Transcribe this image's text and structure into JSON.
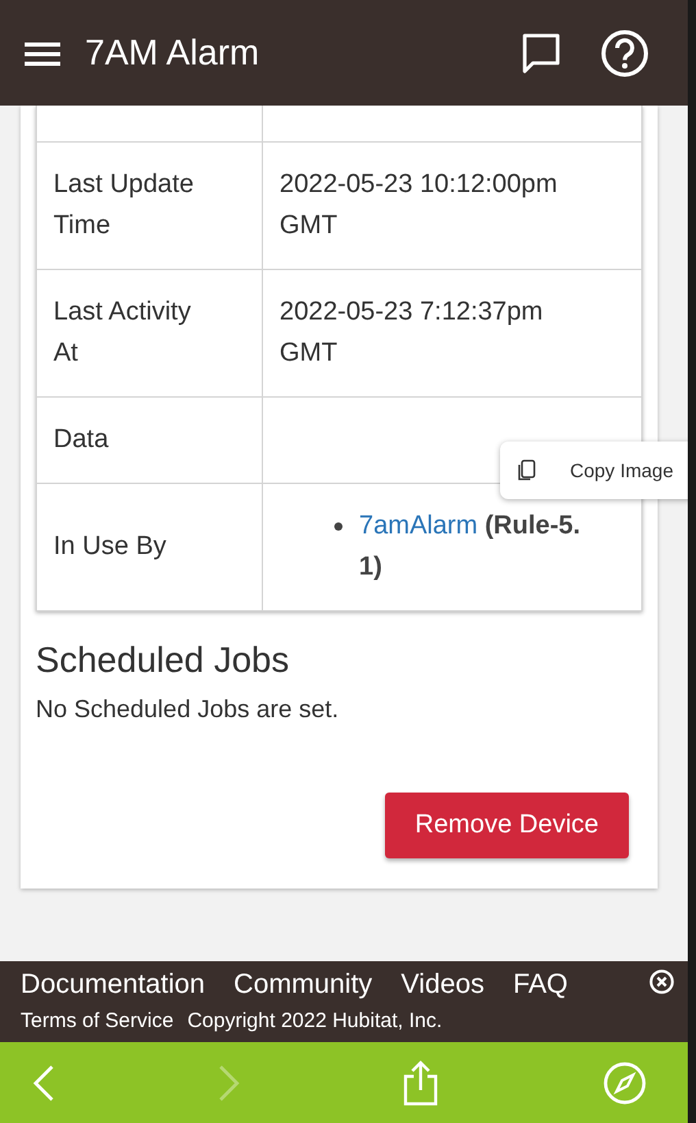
{
  "app_bar": {
    "title": "7AM Alarm"
  },
  "table": {
    "rows": [
      {
        "label": "Last Update Time",
        "value": "2022-05-23 10:12:00pm GMT"
      },
      {
        "label": "Last Activity At",
        "value": "2022-05-23 7:12:37pm GMT"
      },
      {
        "label": "Data",
        "value": ""
      },
      {
        "label": "In Use By",
        "items": [
          {
            "link": "7amAlarm",
            "suffix": "(Rule-5.1)"
          }
        ]
      }
    ]
  },
  "scheduled_jobs": {
    "heading": "Scheduled Jobs",
    "message": "No Scheduled Jobs are set."
  },
  "remove_button": "Remove Device",
  "context_menu": {
    "items": [
      {
        "label": "Copy Image"
      }
    ]
  },
  "footer": {
    "links": [
      "Documentation",
      "Community",
      "Videos",
      "FAQ"
    ],
    "terms": "Terms of Service",
    "copyright": "Copyright 2022 Hubitat, Inc."
  },
  "browser_bar": {
    "back_disabled": false,
    "forward_disabled": true
  }
}
